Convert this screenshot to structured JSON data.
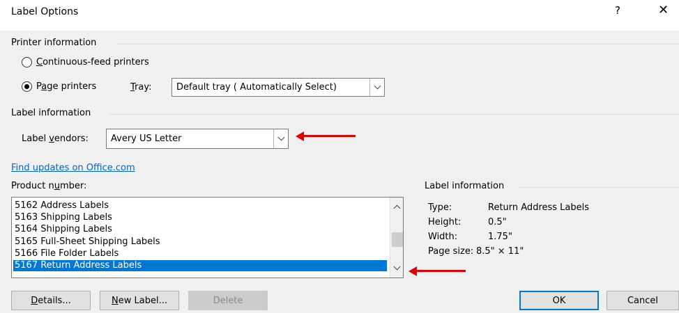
{
  "window": {
    "title": "Label Options",
    "help_glyph": "?",
    "close_glyph": "✕"
  },
  "printer_info": {
    "group_label": "Printer information",
    "continuous_label_pre": "",
    "continuous_accel": "C",
    "continuous_label_post": "ontinuous-feed printers",
    "continuous_checked": false,
    "page_label_pre": "P",
    "page_accel": "a",
    "page_label_post": "ge printers",
    "page_checked": true,
    "tray_accel": "T",
    "tray_label_post": "ray:",
    "tray_value": "Default tray ( Automatically Select)"
  },
  "label_info": {
    "group_label": "Label information",
    "vendor_label_pre": "Label ",
    "vendor_accel": "v",
    "vendor_label_post": "endors:",
    "vendor_value": "Avery US Letter",
    "find_updates_link": "Find updates on Office.com"
  },
  "product": {
    "label_pre": "Product n",
    "label_accel": "u",
    "label_post": "mber:",
    "items": [
      "5162 Address Labels",
      "5163 Shipping Labels",
      "5164 Shipping Labels",
      "5165 Full-Sheet Shipping Labels",
      "5166 File Folder Labels",
      "5167 Return Address Labels"
    ],
    "selected_index": 5
  },
  "details": {
    "group_label": "Label information",
    "type_key": "Type:",
    "type_val": "Return Address Labels",
    "height_key": "Height:",
    "height_val": "0.5\"",
    "width_key": "Width:",
    "width_val": "1.75\"",
    "page_key": "Page size:",
    "page_val": "8.5\" × 11\""
  },
  "buttons": {
    "details_accel": "D",
    "details_post": "etails...",
    "new_accel": "N",
    "new_post": "ew Label...",
    "delete": "Delete",
    "ok": "OK",
    "cancel": "Cancel"
  },
  "colors": {
    "selection": "#0078d7",
    "link": "#0066cc",
    "annotation_arrow": "#e00000"
  }
}
